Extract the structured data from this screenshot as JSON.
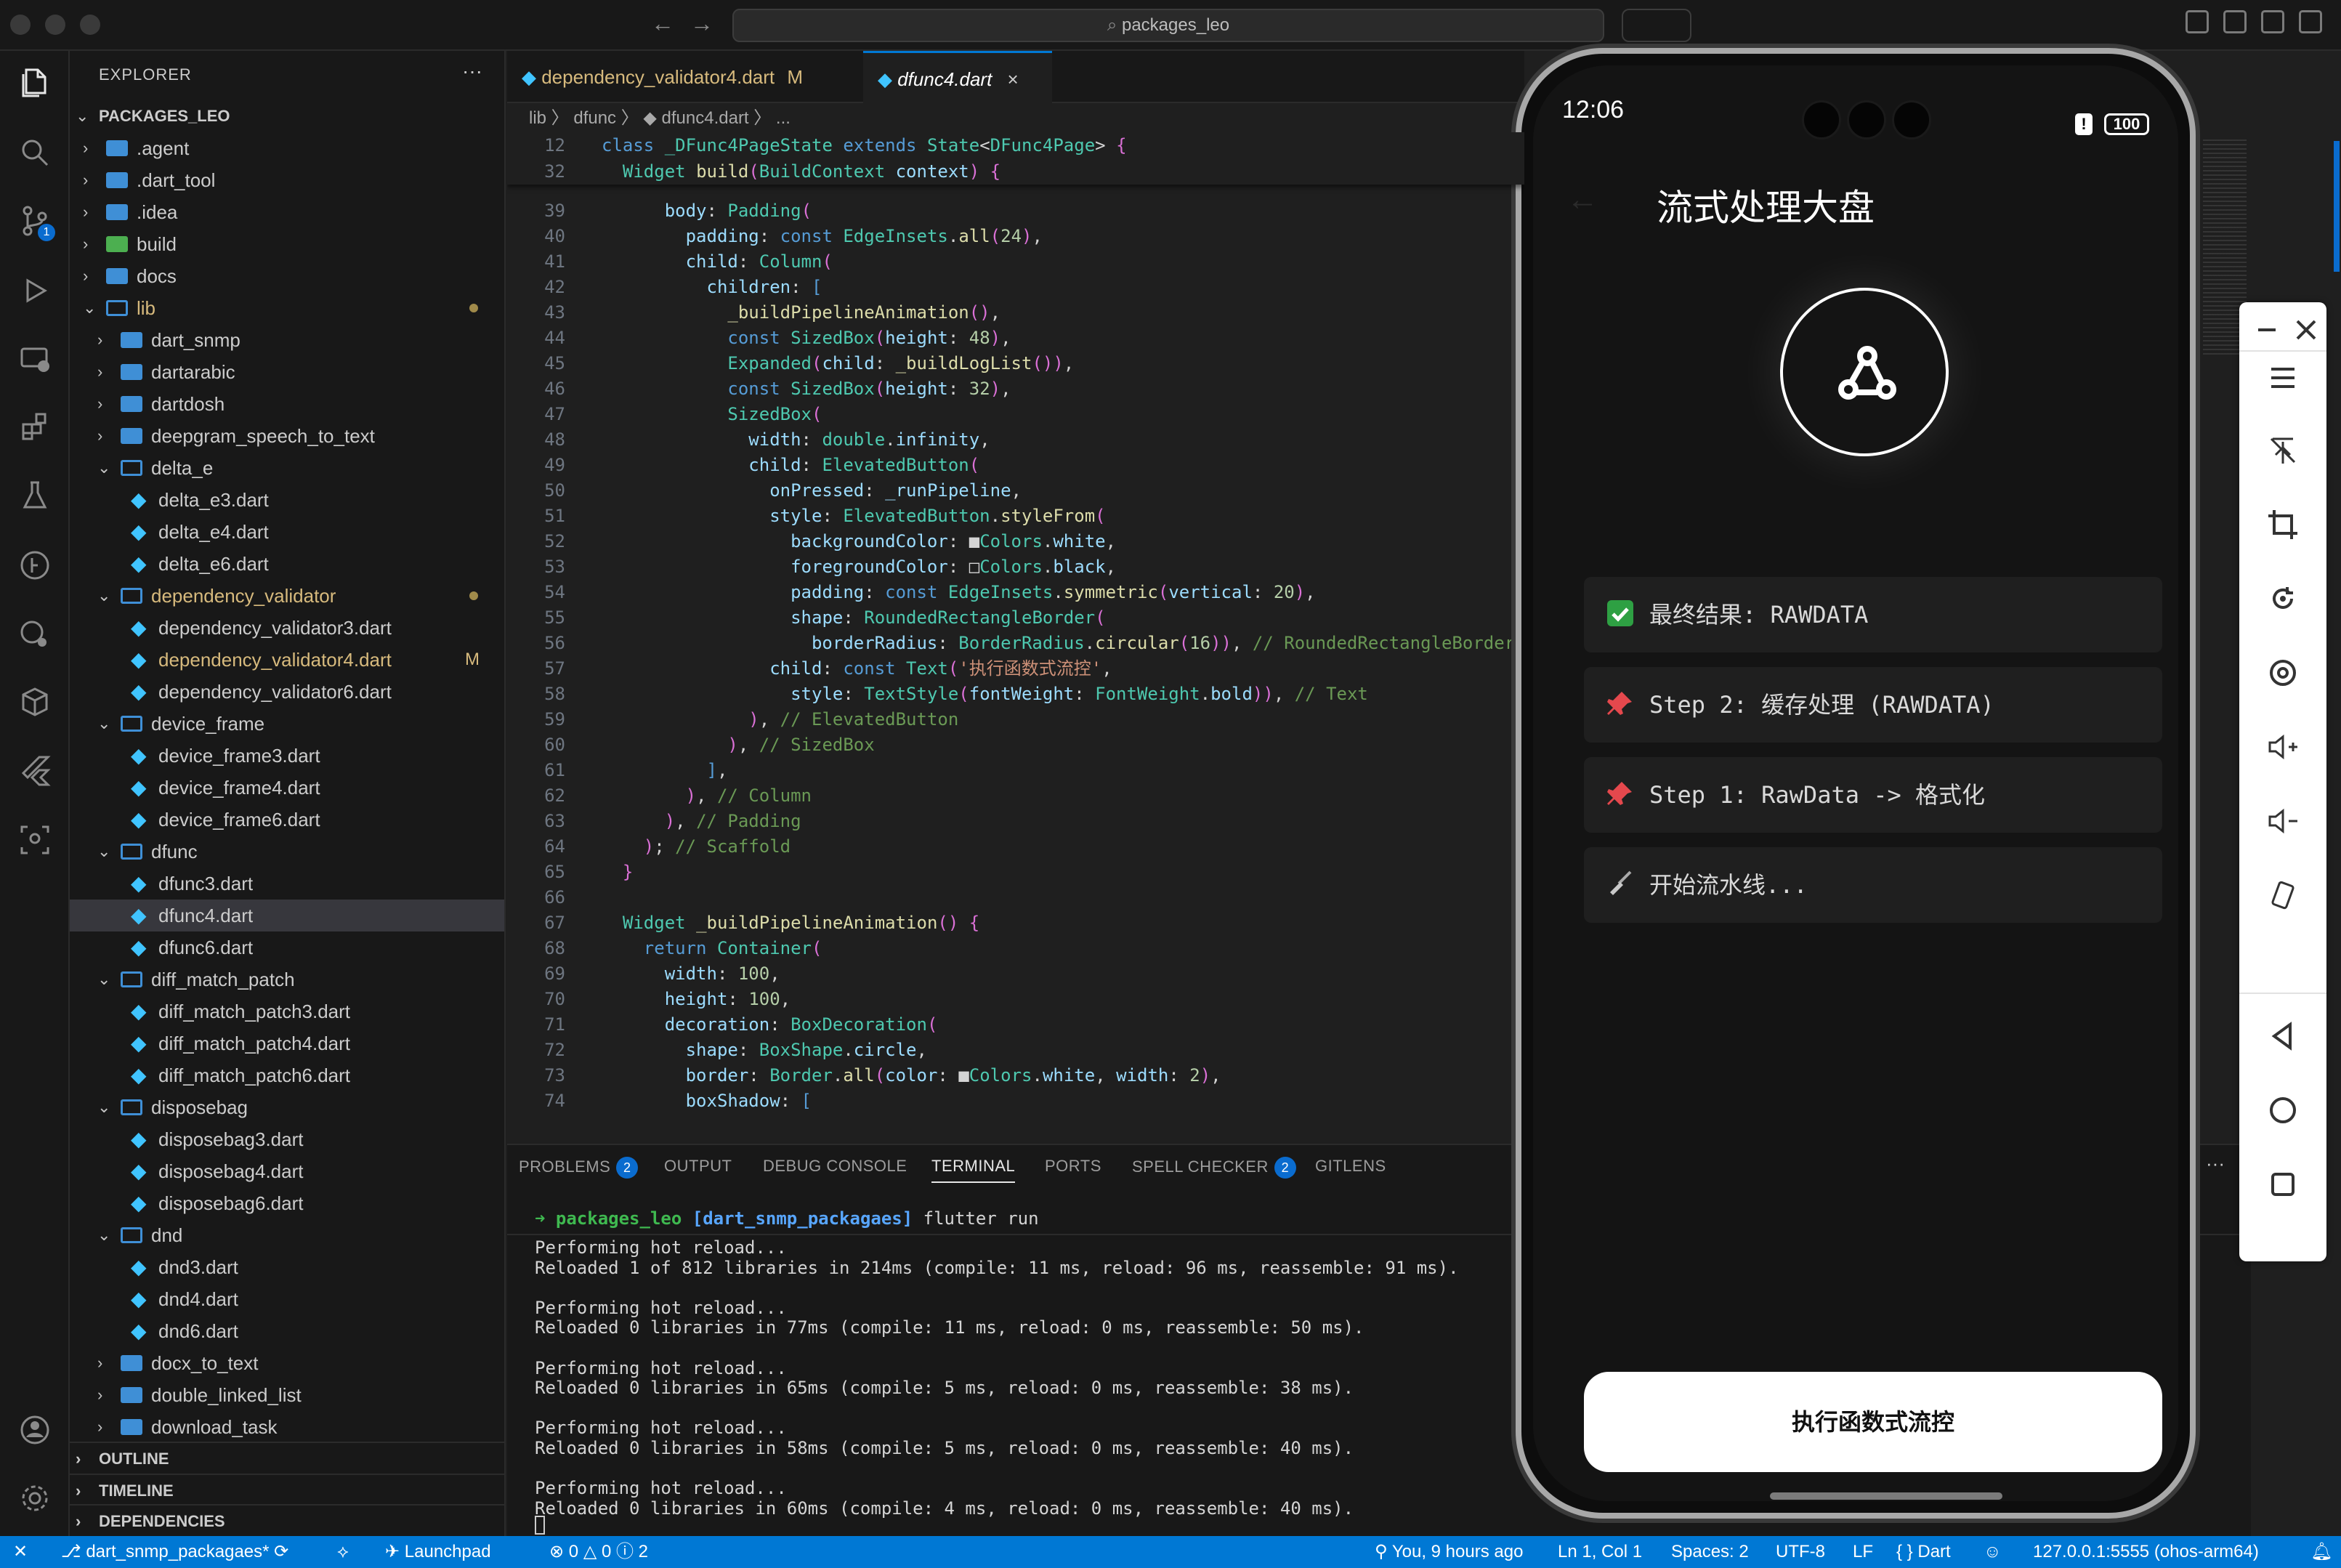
{
  "titlebar": {
    "search_text": "packages_leo",
    "nav_back": "←",
    "nav_forward": "→"
  },
  "activity_bar": {
    "scm_badge": "1"
  },
  "explorer": {
    "title": "EXPLORER",
    "more": "···",
    "root": "PACKAGES_LEO",
    "items": [
      {
        "label": ".agent",
        "type": "folder",
        "level": 1,
        "open": false
      },
      {
        "label": ".dart_tool",
        "type": "folder",
        "level": 1,
        "open": false
      },
      {
        "label": ".idea",
        "type": "folder",
        "level": 1,
        "open": false
      },
      {
        "label": "build",
        "type": "folder-special",
        "level": 1,
        "open": false
      },
      {
        "label": "docs",
        "type": "folder",
        "level": 1,
        "open": false
      },
      {
        "label": "lib",
        "type": "folder",
        "level": 1,
        "open": true,
        "modified_dot": true,
        "color": "#d7ba7d"
      },
      {
        "label": "dart_snmp",
        "type": "folder",
        "level": 2,
        "open": false
      },
      {
        "label": "dartarabic",
        "type": "folder",
        "level": 2,
        "open": false
      },
      {
        "label": "dartdosh",
        "type": "folder",
        "level": 2,
        "open": false
      },
      {
        "label": "deepgram_speech_to_text",
        "type": "folder",
        "level": 2,
        "open": false
      },
      {
        "label": "delta_e",
        "type": "folder",
        "level": 2,
        "open": true
      },
      {
        "label": "delta_e3.dart",
        "type": "dart",
        "level": 3
      },
      {
        "label": "delta_e4.dart",
        "type": "dart",
        "level": 3
      },
      {
        "label": "delta_e6.dart",
        "type": "dart",
        "level": 3
      },
      {
        "label": "dependency_validator",
        "type": "folder",
        "level": 2,
        "open": true,
        "modified_dot": true,
        "color": "#d7ba7d"
      },
      {
        "label": "dependency_validator3.dart",
        "type": "dart",
        "level": 3
      },
      {
        "label": "dependency_validator4.dart",
        "type": "dart",
        "level": 3,
        "modified": "M",
        "color": "#d7ba7d"
      },
      {
        "label": "dependency_validator6.dart",
        "type": "dart",
        "level": 3
      },
      {
        "label": "device_frame",
        "type": "folder",
        "level": 2,
        "open": true
      },
      {
        "label": "device_frame3.dart",
        "type": "dart",
        "level": 3
      },
      {
        "label": "device_frame4.dart",
        "type": "dart",
        "level": 3
      },
      {
        "label": "device_frame6.dart",
        "type": "dart",
        "level": 3
      },
      {
        "label": "dfunc",
        "type": "folder",
        "level": 2,
        "open": true
      },
      {
        "label": "dfunc3.dart",
        "type": "dart",
        "level": 3
      },
      {
        "label": "dfunc4.dart",
        "type": "dart",
        "level": 3,
        "selected": true
      },
      {
        "label": "dfunc6.dart",
        "type": "dart",
        "level": 3
      },
      {
        "label": "diff_match_patch",
        "type": "folder",
        "level": 2,
        "open": true
      },
      {
        "label": "diff_match_patch3.dart",
        "type": "dart",
        "level": 3
      },
      {
        "label": "diff_match_patch4.dart",
        "type": "dart",
        "level": 3
      },
      {
        "label": "diff_match_patch6.dart",
        "type": "dart",
        "level": 3
      },
      {
        "label": "disposebag",
        "type": "folder",
        "level": 2,
        "open": true
      },
      {
        "label": "disposebag3.dart",
        "type": "dart",
        "level": 3
      },
      {
        "label": "disposebag4.dart",
        "type": "dart",
        "level": 3
      },
      {
        "label": "disposebag6.dart",
        "type": "dart",
        "level": 3
      },
      {
        "label": "dnd",
        "type": "folder",
        "level": 2,
        "open": true
      },
      {
        "label": "dnd3.dart",
        "type": "dart",
        "level": 3
      },
      {
        "label": "dnd4.dart",
        "type": "dart",
        "level": 3
      },
      {
        "label": "dnd6.dart",
        "type": "dart",
        "level": 3
      },
      {
        "label": "docx_to_text",
        "type": "folder",
        "level": 2,
        "open": false
      },
      {
        "label": "double_linked_list",
        "type": "folder",
        "level": 2,
        "open": false
      },
      {
        "label": "download_task",
        "type": "folder",
        "level": 2,
        "open": false
      }
    ],
    "sections": [
      "OUTLINE",
      "TIMELINE",
      "DEPENDENCIES"
    ]
  },
  "tabs": [
    {
      "label": "dependency_validator4.dart",
      "badge": "M",
      "active": false
    },
    {
      "label": "dfunc4.dart",
      "badge": "×",
      "active": true
    }
  ],
  "breadcrumb": "lib 〉 dfunc 〉 ◆ dfunc4.dart 〉 ...",
  "code": {
    "sticky": [
      {
        "num": "12",
        "html": "<span class=\"kw\">class</span> <span class=\"ty\">_DFunc4PageState</span> <span class=\"kw\">extends</span> <span class=\"ty\">State</span>&lt;<span class=\"ty\">DFunc4Page</span>&gt; <span class=\"pn\">{</span>"
      },
      {
        "num": "32",
        "html": "  <span class=\"ty\">Widget</span> <span class=\"fn\">build</span><span class=\"pn\">(</span><span class=\"ty\">BuildContext</span> <span class=\"pr\">context</span><span class=\"pn\">)</span> <span class=\"pn\">{</span>"
      }
    ],
    "lines": [
      {
        "num": "39",
        "html": "      <span class=\"pr\">body</span>: <span class=\"ty\">Padding</span><span class=\"pn\">(</span>"
      },
      {
        "num": "40",
        "html": "        <span class=\"pr\">padding</span>: <span class=\"kw\">const</span> <span class=\"ty\">EdgeInsets</span>.<span class=\"fn\">all</span><span class=\"pn\">(</span><span class=\"num\">24</span><span class=\"pn\">)</span>,"
      },
      {
        "num": "41",
        "html": "        <span class=\"pr\">child</span>: <span class=\"ty\">Column</span><span class=\"pn\">(</span>"
      },
      {
        "num": "42",
        "html": "          <span class=\"pr\">children</span>: <span class=\"kw\">[</span>"
      },
      {
        "num": "43",
        "html": "            <span class=\"fn\">_buildPipelineAnimation</span><span class=\"pn\">()</span>,"
      },
      {
        "num": "44",
        "html": "            <span class=\"kw\">const</span> <span class=\"ty\">SizedBox</span><span class=\"pn\">(</span><span class=\"pr\">height</span>: <span class=\"num\">48</span><span class=\"pn\">)</span>,"
      },
      {
        "num": "45",
        "html": "            <span class=\"ty\">Expanded</span><span class=\"pn\">(</span><span class=\"pr\">child</span>: <span class=\"fn\">_buildLogList</span><span class=\"pn\">())</span>,"
      },
      {
        "num": "46",
        "html": "            <span class=\"kw\">const</span> <span class=\"ty\">SizedBox</span><span class=\"pn\">(</span><span class=\"pr\">height</span>: <span class=\"num\">32</span><span class=\"pn\">)</span>,"
      },
      {
        "num": "47",
        "html": "            <span class=\"ty\">SizedBox</span><span class=\"pn\">(</span>"
      },
      {
        "num": "48",
        "html": "              <span class=\"pr\">width</span>: <span class=\"ty\">double</span>.<span class=\"pr\">infinity</span>,"
      },
      {
        "num": "49",
        "html": "              <span class=\"pr\">child</span>: <span class=\"ty\">ElevatedButton</span><span class=\"pn\">(</span>"
      },
      {
        "num": "50",
        "html": "                <span class=\"pr\">onPressed</span>: <span class=\"pr\">_runPipeline</span>,"
      },
      {
        "num": "51",
        "html": "                <span class=\"pr\">style</span>: <span class=\"ty\">ElevatedButton</span>.<span class=\"fn\">styleFrom</span><span class=\"pn\">(</span>"
      },
      {
        "num": "52",
        "html": "                  <span class=\"pr\">backgroundColor</span>: ■<span class=\"ty\">Colors</span>.<span class=\"pr\">white</span>,"
      },
      {
        "num": "53",
        "html": "                  <span class=\"pr\">foregroundColor</span>: □<span class=\"ty\">Colors</span>.<span class=\"pr\">black</span>,"
      },
      {
        "num": "54",
        "html": "                  <span class=\"pr\">padding</span>: <span class=\"kw\">const</span> <span class=\"ty\">EdgeInsets</span>.<span class=\"fn\">symmetric</span><span class=\"pn\">(</span><span class=\"pr\">vertical</span>: <span class=\"num\">20</span><span class=\"pn\">)</span>,"
      },
      {
        "num": "55",
        "html": "                  <span class=\"pr\">shape</span>: <span class=\"ty\">RoundedRectangleBorder</span><span class=\"pn\">(</span>"
      },
      {
        "num": "56",
        "html": "                    <span class=\"pr\">borderRadius</span>: <span class=\"ty\">BorderRadius</span>.<span class=\"fn\">circular</span><span class=\"pn\">(</span><span class=\"num\">16</span><span class=\"pn\">))</span>, <span class=\"cm\">// RoundedRectangleBorder</span>"
      },
      {
        "num": "57",
        "html": "                <span class=\"pr\">child</span>: <span class=\"kw\">const</span> <span class=\"ty\">Text</span><span class=\"pn\">(</span><span class=\"str\">'执行函数式流控'</span>,"
      },
      {
        "num": "58",
        "html": "                  <span class=\"pr\">style</span>: <span class=\"ty\">TextStyle</span><span class=\"pn\">(</span><span class=\"pr\">fontWeight</span>: <span class=\"ty\">FontWeight</span>.<span class=\"pr\">bold</span><span class=\"pn\">))</span>, <span class=\"cm\">// Text</span>"
      },
      {
        "num": "59",
        "html": "              <span class=\"pn\">)</span>, <span class=\"cm\">// ElevatedButton</span>"
      },
      {
        "num": "60",
        "html": "            <span class=\"pn\">)</span>, <span class=\"cm\">// SizedBox</span>"
      },
      {
        "num": "61",
        "html": "          <span class=\"kw\">]</span>,"
      },
      {
        "num": "62",
        "html": "        <span class=\"pn\">)</span>, <span class=\"cm\">// Column</span>"
      },
      {
        "num": "63",
        "html": "      <span class=\"pn\">)</span>, <span class=\"cm\">// Padding</span>"
      },
      {
        "num": "64",
        "html": "    <span class=\"pn\">)</span>; <span class=\"cm\">// Scaffold</span>"
      },
      {
        "num": "65",
        "html": "  <span class=\"pn\">}</span>"
      },
      {
        "num": "66",
        "html": ""
      },
      {
        "num": "67",
        "html": "  <span class=\"ty\">Widget</span> <span class=\"fn\">_buildPipelineAnimation</span><span class=\"pn\">()</span> <span class=\"pn\">{</span>"
      },
      {
        "num": "68",
        "html": "    <span class=\"kw\">return</span> <span class=\"ty\">Container</span><span class=\"pn\">(</span>"
      },
      {
        "num": "69",
        "html": "      <span class=\"pr\">width</span>: <span class=\"num\">100</span>,"
      },
      {
        "num": "70",
        "html": "      <span class=\"pr\">height</span>: <span class=\"num\">100</span>,"
      },
      {
        "num": "71",
        "html": "      <span class=\"pr\">decoration</span>: <span class=\"ty\">BoxDecoration</span><span class=\"pn\">(</span>"
      },
      {
        "num": "72",
        "html": "        <span class=\"pr\">shape</span>: <span class=\"ty\">BoxShape</span>.<span class=\"pr\">circle</span>,"
      },
      {
        "num": "73",
        "html": "        <span class=\"pr\">border</span>: <span class=\"ty\">Border</span>.<span class=\"fn\">all</span><span class=\"pn\">(</span><span class=\"pr\">color</span>: ■<span class=\"ty\">Colors</span>.<span class=\"pr\">white</span>, <span class=\"pr\">width</span>: <span class=\"num\">2</span><span class=\"pn\">)</span>,"
      },
      {
        "num": "74",
        "html": "        <span class=\"pr\">boxShadow</span>: <span class=\"kw\">[</span>"
      }
    ]
  },
  "panel": {
    "tabs": [
      {
        "label": "PROBLEMS",
        "badge": "2"
      },
      {
        "label": "OUTPUT"
      },
      {
        "label": "DEBUG CONSOLE"
      },
      {
        "label": "TERMINAL",
        "active": true
      },
      {
        "label": "PORTS"
      },
      {
        "label": "SPELL CHECKER",
        "badge": "2"
      },
      {
        "label": "GITLENS"
      }
    ],
    "more": "···",
    "prompt_dir": "packages_leo",
    "prompt_branch": "[dart_snmp_packagaes]",
    "prompt_cmd": "flutter run",
    "terminal": [
      "Performing hot reload...",
      "Reloaded 1 of 812 libraries in 214ms (compile: 11 ms, reload: 96 ms, reassemble: 91 ms).",
      "",
      "Performing hot reload...",
      "Reloaded 0 libraries in 77ms (compile: 11 ms, reload: 0 ms, reassemble: 50 ms).",
      "",
      "Performing hot reload...",
      "Reloaded 0 libraries in 65ms (compile: 5 ms, reload: 0 ms, reassemble: 38 ms).",
      "",
      "Performing hot reload...",
      "Reloaded 0 libraries in 58ms (compile: 5 ms, reload: 0 ms, reassemble: 40 ms).",
      "",
      "Performing hot reload...",
      "Reloaded 0 libraries in 60ms (compile: 4 ms, reload: 0 ms, reassemble: 40 ms)."
    ]
  },
  "statusbar": {
    "remote": "✕",
    "branch": "dart_snmp_packagaes*",
    "launchpad": "Launchpad",
    "errors": "0",
    "warnings": "0",
    "info": "2",
    "blame": "You, 9 hours ago",
    "position": "Ln 1, Col 1",
    "spaces": "Spaces: 2",
    "encoding": "UTF-8",
    "eol": "LF",
    "language": "Dart",
    "device": "127.0.0.1:5555 (ohos-arm64)"
  },
  "phone": {
    "time": "12:06",
    "battery": "100",
    "battery_alert": "!",
    "title": "流式处理大盘",
    "logs": [
      {
        "icon": "check-icon",
        "text": "最终结果: RAWDATA"
      },
      {
        "icon": "pin-icon",
        "text": "Step 2: 缓存处理 (RAWDATA)"
      },
      {
        "icon": "pin-icon",
        "text": "Step 1: RawData -> 格式化"
      },
      {
        "icon": "broom-icon",
        "text": "开始流水线..."
      }
    ],
    "button": "执行函数式流控"
  },
  "colors": {
    "accent": "#0078d4",
    "editor_bg": "#1f1f1f",
    "modified": "#d7ba7d"
  }
}
